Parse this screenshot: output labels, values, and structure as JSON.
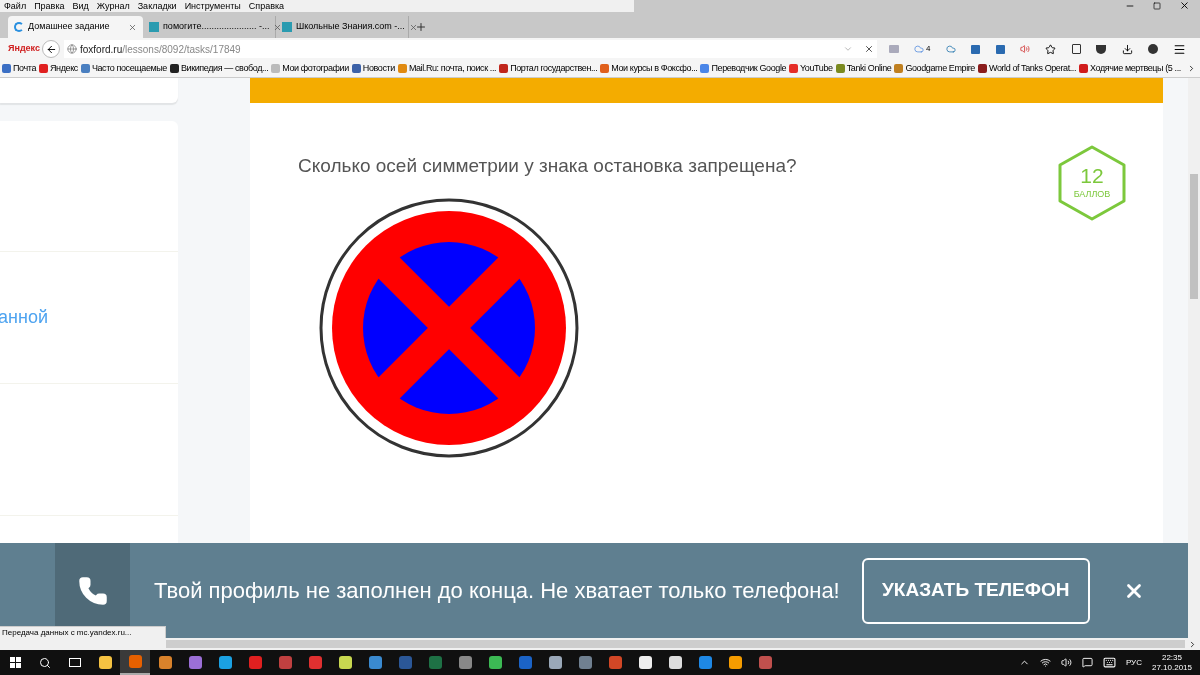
{
  "menu": [
    "Файл",
    "Правка",
    "Вид",
    "Журнал",
    "Закладки",
    "Инструменты",
    "Справка"
  ],
  "tabs": [
    {
      "label": "Домашнее задание",
      "selected": true,
      "loading": true
    },
    {
      "label": "помогите...................... -...",
      "selected": false,
      "loading": false
    },
    {
      "label": "Школьные Знания.com -...",
      "selected": false,
      "loading": false
    }
  ],
  "nav": {
    "logo": "Яндекс",
    "url_domain": "foxford.ru",
    "url_path": "/lessons/8092/tasks/17849",
    "weather_count": "4"
  },
  "bookmarks": [
    {
      "label": "Почта",
      "color": "#3b6fc4"
    },
    {
      "label": "Яндекс",
      "color": "#e02020"
    },
    {
      "label": "Часто посещаемые",
      "color": "#4a7fc0"
    },
    {
      "label": "Википедия — свобод...",
      "color": "#222222"
    },
    {
      "label": "Мои фотографии",
      "color": "#bbbbbb"
    },
    {
      "label": "Новости",
      "color": "#3d62a8"
    },
    {
      "label": "Mail.Ru: почта, поиск ...",
      "color": "#e08a10"
    },
    {
      "label": "Портал государствен...",
      "color": "#c0261c"
    },
    {
      "label": "Мои курсы в Фоксфо...",
      "color": "#e0601c"
    },
    {
      "label": "Переводчик Google",
      "color": "#4a86e8"
    },
    {
      "label": "YouTube",
      "color": "#e52d27"
    },
    {
      "label": "Tanki Online",
      "color": "#7a8a20"
    },
    {
      "label": "Goodgame Empire",
      "color": "#c08020"
    },
    {
      "label": "World of Tanks Operat...",
      "color": "#8a1c1c"
    },
    {
      "label": "Ходячие мертвецы (5 ...",
      "color": "#d01c1c"
    }
  ],
  "sidebar": {
    "link_fragment": "анной"
  },
  "task": {
    "question": "Сколько осей симметрии у знака остановка запрещена?",
    "points": "12",
    "points_label": "БАЛЛОВ"
  },
  "banner": {
    "message": "Твой профиль не заполнен до конца. Не хватает только телефона!",
    "button": "УКАЗАТЬ ТЕЛЕФОН"
  },
  "status_text": "Передача данных с mc.yandex.ru...",
  "taskbar": {
    "apps": [
      {
        "color": "#f5c242",
        "selected": false
      },
      {
        "color": "#e66000",
        "selected": true
      },
      {
        "color": "#d9822b",
        "selected": false
      },
      {
        "color": "#9b6fd6",
        "selected": false
      },
      {
        "color": "#1ba1e2",
        "selected": false
      },
      {
        "color": "#e02020",
        "selected": false
      },
      {
        "color": "#c04040",
        "selected": false
      },
      {
        "color": "#e03030",
        "selected": false
      },
      {
        "color": "#c8d850",
        "selected": false
      },
      {
        "color": "#3a8ad0",
        "selected": false
      },
      {
        "color": "#2b5797",
        "selected": false
      },
      {
        "color": "#1e7145",
        "selected": false
      },
      {
        "color": "#888888",
        "selected": false
      },
      {
        "color": "#3cba54",
        "selected": false
      },
      {
        "color": "#1b63c6",
        "selected": false
      },
      {
        "color": "#9aa8b8",
        "selected": false
      },
      {
        "color": "#708090",
        "selected": false
      },
      {
        "color": "#d24726",
        "selected": false
      },
      {
        "color": "#eeeeee",
        "selected": false
      },
      {
        "color": "#dddddd",
        "selected": false
      },
      {
        "color": "#1e88e5",
        "selected": false
      },
      {
        "color": "#f59c00",
        "selected": false
      },
      {
        "color": "#c0504d",
        "selected": false
      }
    ],
    "language": "РУС",
    "time": "22:35",
    "date": "27.10.2015"
  }
}
